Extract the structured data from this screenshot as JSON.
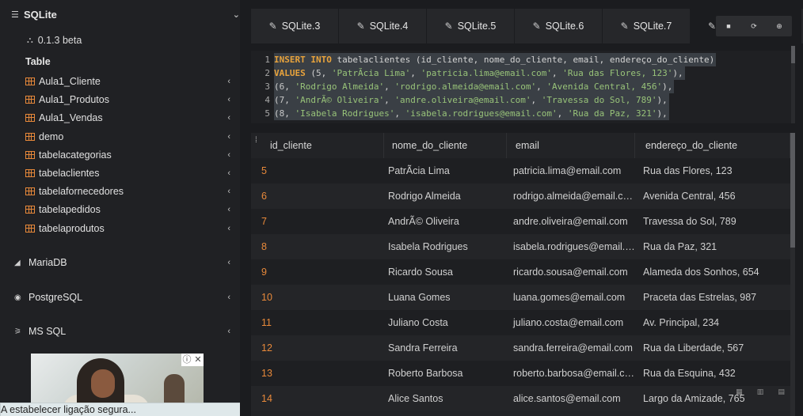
{
  "sidebar": {
    "sqlite_label": "SQLite",
    "version": "0.1.3 beta",
    "table_heading": "Table",
    "tables": [
      "Aula1_Cliente",
      "Aula1_Produtos",
      "Aula1_Vendas",
      "demo",
      "tabelacategorias",
      "tabelaclientes",
      "tabelafornecedores",
      "tabelapedidos",
      "tabelaprodutos"
    ],
    "databases": [
      "MariaDB",
      "PostgreSQL",
      "MS SQL"
    ]
  },
  "status_text": "A estabelecer ligação segura...",
  "tabs": [
    "SQLite.3",
    "SQLite.4",
    "SQLite.5",
    "SQLite.6",
    "SQLite.7"
  ],
  "editor": {
    "lines": [
      {
        "n": "1",
        "kw": "INSERT INTO",
        "rest": " tabelaclientes (id_cliente, nome_do_cliente, email, endereço_do_cliente)"
      },
      {
        "n": "2",
        "kw": "VALUES",
        "rest": " (5, 'PatrÃ­cia Lima', 'patricia.lima@email.com', 'Rua das Flores, 123'),"
      },
      {
        "n": "3",
        "kw": "",
        "rest": "(6, 'Rodrigo Almeida', 'rodrigo.almeida@email.com', 'Avenida Central, 456'),"
      },
      {
        "n": "4",
        "kw": "",
        "rest": "(7, 'AndrÃ© Oliveira', 'andre.oliveira@email.com', 'Travessa do Sol, 789'),"
      },
      {
        "n": "5",
        "kw": "",
        "rest": "(8, 'Isabela Rodrigues', 'isabela.rodrigues@email.com', 'Rua da Paz, 321'),"
      }
    ]
  },
  "results": {
    "columns": [
      "id_cliente",
      "nome_do_cliente",
      "email",
      "endereço_do_cliente"
    ],
    "rows": [
      [
        "5",
        "PatrÃ­cia Lima",
        "patricia.lima@email.com",
        "Rua das Flores, 123"
      ],
      [
        "6",
        "Rodrigo Almeida",
        "rodrigo.almeida@email.com",
        "Avenida Central, 456"
      ],
      [
        "7",
        "AndrÃ© Oliveira",
        "andre.oliveira@email.com",
        "Travessa do Sol, 789"
      ],
      [
        "8",
        "Isabela Rodrigues",
        "isabela.rodrigues@email.com",
        "Rua da Paz, 321"
      ],
      [
        "9",
        "Ricardo Sousa",
        "ricardo.sousa@email.com",
        "Alameda dos Sonhos, 654"
      ],
      [
        "10",
        "Luana Gomes",
        "luana.gomes@email.com",
        "Praceta das Estrelas, 987"
      ],
      [
        "11",
        "Juliano Costa",
        "juliano.costa@email.com",
        "Av. Principal, 234"
      ],
      [
        "12",
        "Sandra Ferreira",
        "sandra.ferreira@email.com",
        "Rua da Liberdade, 567"
      ],
      [
        "13",
        "Roberto Barbosa",
        "roberto.barbosa@email.com",
        "Rua da Esquina, 432"
      ],
      [
        "14",
        "Alice Santos",
        "alice.santos@email.com",
        "Largo da Amizade, 765"
      ]
    ]
  },
  "colors": {
    "accent": "#e8893a",
    "keyword": "#e8a33c",
    "string": "#98c379"
  }
}
